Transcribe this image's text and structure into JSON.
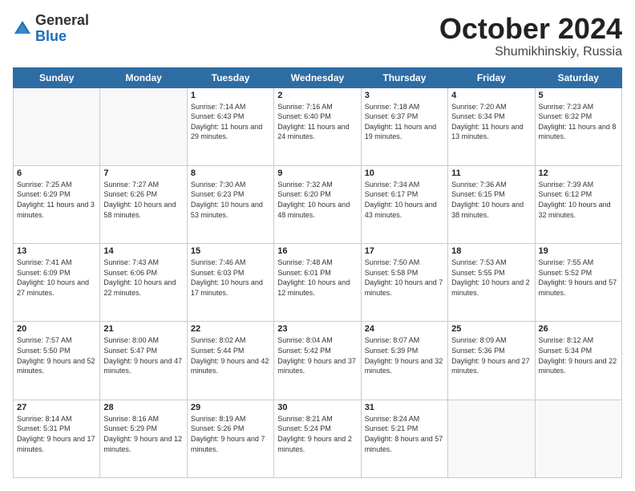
{
  "logo": {
    "general": "General",
    "blue": "Blue"
  },
  "title": "October 2024",
  "subtitle": "Shumikhinskiy, Russia",
  "headers": [
    "Sunday",
    "Monday",
    "Tuesday",
    "Wednesday",
    "Thursday",
    "Friday",
    "Saturday"
  ],
  "weeks": [
    [
      {
        "day": "",
        "info": ""
      },
      {
        "day": "",
        "info": ""
      },
      {
        "day": "1",
        "info": "Sunrise: 7:14 AM\nSunset: 6:43 PM\nDaylight: 11 hours and 29 minutes."
      },
      {
        "day": "2",
        "info": "Sunrise: 7:16 AM\nSunset: 6:40 PM\nDaylight: 11 hours and 24 minutes."
      },
      {
        "day": "3",
        "info": "Sunrise: 7:18 AM\nSunset: 6:37 PM\nDaylight: 11 hours and 19 minutes."
      },
      {
        "day": "4",
        "info": "Sunrise: 7:20 AM\nSunset: 6:34 PM\nDaylight: 11 hours and 13 minutes."
      },
      {
        "day": "5",
        "info": "Sunrise: 7:23 AM\nSunset: 6:32 PM\nDaylight: 11 hours and 8 minutes."
      }
    ],
    [
      {
        "day": "6",
        "info": "Sunrise: 7:25 AM\nSunset: 6:29 PM\nDaylight: 11 hours and 3 minutes."
      },
      {
        "day": "7",
        "info": "Sunrise: 7:27 AM\nSunset: 6:26 PM\nDaylight: 10 hours and 58 minutes."
      },
      {
        "day": "8",
        "info": "Sunrise: 7:30 AM\nSunset: 6:23 PM\nDaylight: 10 hours and 53 minutes."
      },
      {
        "day": "9",
        "info": "Sunrise: 7:32 AM\nSunset: 6:20 PM\nDaylight: 10 hours and 48 minutes."
      },
      {
        "day": "10",
        "info": "Sunrise: 7:34 AM\nSunset: 6:17 PM\nDaylight: 10 hours and 43 minutes."
      },
      {
        "day": "11",
        "info": "Sunrise: 7:36 AM\nSunset: 6:15 PM\nDaylight: 10 hours and 38 minutes."
      },
      {
        "day": "12",
        "info": "Sunrise: 7:39 AM\nSunset: 6:12 PM\nDaylight: 10 hours and 32 minutes."
      }
    ],
    [
      {
        "day": "13",
        "info": "Sunrise: 7:41 AM\nSunset: 6:09 PM\nDaylight: 10 hours and 27 minutes."
      },
      {
        "day": "14",
        "info": "Sunrise: 7:43 AM\nSunset: 6:06 PM\nDaylight: 10 hours and 22 minutes."
      },
      {
        "day": "15",
        "info": "Sunrise: 7:46 AM\nSunset: 6:03 PM\nDaylight: 10 hours and 17 minutes."
      },
      {
        "day": "16",
        "info": "Sunrise: 7:48 AM\nSunset: 6:01 PM\nDaylight: 10 hours and 12 minutes."
      },
      {
        "day": "17",
        "info": "Sunrise: 7:50 AM\nSunset: 5:58 PM\nDaylight: 10 hours and 7 minutes."
      },
      {
        "day": "18",
        "info": "Sunrise: 7:53 AM\nSunset: 5:55 PM\nDaylight: 10 hours and 2 minutes."
      },
      {
        "day": "19",
        "info": "Sunrise: 7:55 AM\nSunset: 5:52 PM\nDaylight: 9 hours and 57 minutes."
      }
    ],
    [
      {
        "day": "20",
        "info": "Sunrise: 7:57 AM\nSunset: 5:50 PM\nDaylight: 9 hours and 52 minutes."
      },
      {
        "day": "21",
        "info": "Sunrise: 8:00 AM\nSunset: 5:47 PM\nDaylight: 9 hours and 47 minutes."
      },
      {
        "day": "22",
        "info": "Sunrise: 8:02 AM\nSunset: 5:44 PM\nDaylight: 9 hours and 42 minutes."
      },
      {
        "day": "23",
        "info": "Sunrise: 8:04 AM\nSunset: 5:42 PM\nDaylight: 9 hours and 37 minutes."
      },
      {
        "day": "24",
        "info": "Sunrise: 8:07 AM\nSunset: 5:39 PM\nDaylight: 9 hours and 32 minutes."
      },
      {
        "day": "25",
        "info": "Sunrise: 8:09 AM\nSunset: 5:36 PM\nDaylight: 9 hours and 27 minutes."
      },
      {
        "day": "26",
        "info": "Sunrise: 8:12 AM\nSunset: 5:34 PM\nDaylight: 9 hours and 22 minutes."
      }
    ],
    [
      {
        "day": "27",
        "info": "Sunrise: 8:14 AM\nSunset: 5:31 PM\nDaylight: 9 hours and 17 minutes."
      },
      {
        "day": "28",
        "info": "Sunrise: 8:16 AM\nSunset: 5:29 PM\nDaylight: 9 hours and 12 minutes."
      },
      {
        "day": "29",
        "info": "Sunrise: 8:19 AM\nSunset: 5:26 PM\nDaylight: 9 hours and 7 minutes."
      },
      {
        "day": "30",
        "info": "Sunrise: 8:21 AM\nSunset: 5:24 PM\nDaylight: 9 hours and 2 minutes."
      },
      {
        "day": "31",
        "info": "Sunrise: 8:24 AM\nSunset: 5:21 PM\nDaylight: 8 hours and 57 minutes."
      },
      {
        "day": "",
        "info": ""
      },
      {
        "day": "",
        "info": ""
      }
    ]
  ]
}
